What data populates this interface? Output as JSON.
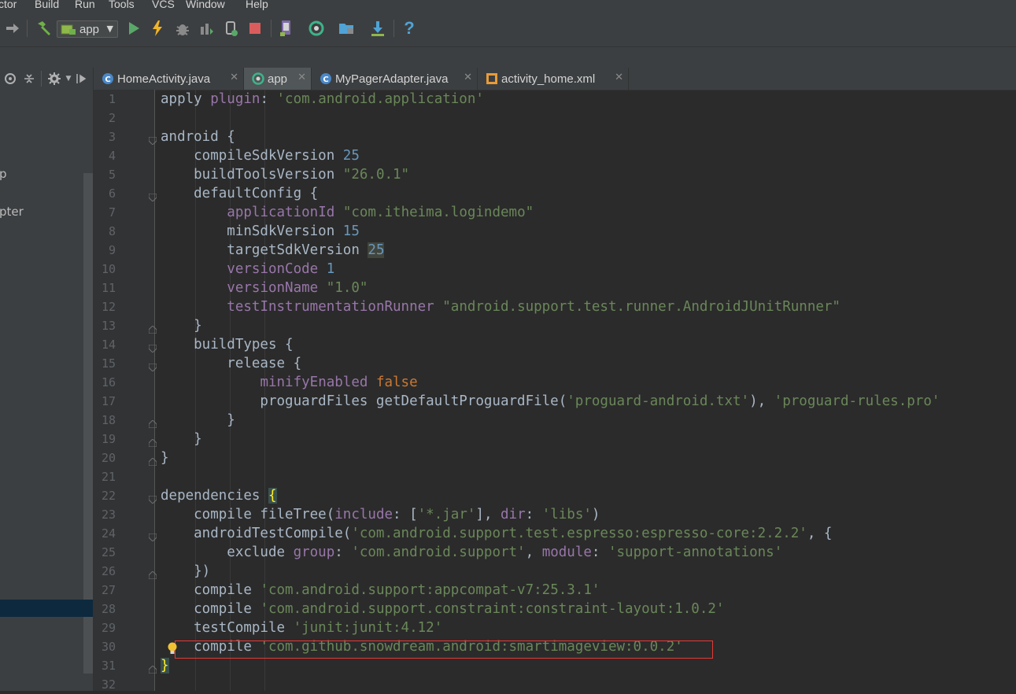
{
  "menu": [
    "ctor",
    "Build",
    "Run",
    "Tools",
    "VCS",
    "Window",
    "Help"
  ],
  "toolbar": {
    "run_config_label": "app",
    "icons": [
      "back-arrow-icon",
      "make-project-icon",
      "run-icon",
      "apply-changes-icon",
      "debug-icon",
      "profile-icon",
      "attach-debugger-icon",
      "stop-icon",
      "avd-manager-icon",
      "sync-gradle-icon",
      "project-structure-icon",
      "sdk-manager-icon",
      "help-icon"
    ]
  },
  "project_panel": {
    "tree_fragments": [
      "p",
      "pter"
    ],
    "toolbar_icons": [
      "locate-icon",
      "collapse-all-icon",
      "gear-icon",
      "hide-panel-icon"
    ]
  },
  "tabs": [
    {
      "label": "HomeActivity.java",
      "icon": "java-class-icon",
      "active": false
    },
    {
      "label": "app",
      "icon": "gradle-icon",
      "active": true
    },
    {
      "label": "MyPagerAdapter.java",
      "icon": "java-class-icon",
      "active": false
    },
    {
      "label": "activity_home.xml",
      "icon": "xml-layout-icon",
      "active": false
    }
  ],
  "editor": {
    "line_numbers": [
      "1",
      "2",
      "3",
      "4",
      "5",
      "6",
      "7",
      "8",
      "9",
      "10",
      "11",
      "12",
      "13",
      "14",
      "15",
      "16",
      "17",
      "18",
      "19",
      "20",
      "21",
      "22",
      "23",
      "24",
      "25",
      "26",
      "27",
      "28",
      "29",
      "30",
      "31",
      "32"
    ],
    "lines": [
      [
        {
          "t": "apply "
        },
        {
          "t": "plugin",
          "c": "p"
        },
        {
          "t": ": "
        },
        {
          "t": "'com.android.application'",
          "c": "s"
        }
      ],
      [],
      [
        {
          "t": "android {"
        }
      ],
      [
        {
          "t": "    compileSdkVersion "
        },
        {
          "t": "25",
          "c": "n"
        }
      ],
      [
        {
          "t": "    buildToolsVersion "
        },
        {
          "t": "\"26.0.1\"",
          "c": "s"
        }
      ],
      [
        {
          "t": "    defaultConfig {"
        }
      ],
      [
        {
          "t": "        "
        },
        {
          "t": "applicationId",
          "c": "p"
        },
        {
          "t": " "
        },
        {
          "t": "\"com.itheima.logindemo\"",
          "c": "s"
        }
      ],
      [
        {
          "t": "        minSdkVersion "
        },
        {
          "t": "15",
          "c": "n"
        }
      ],
      [
        {
          "t": "        targetSdkVersion "
        },
        {
          "t": "25",
          "c": "n hl25"
        }
      ],
      [
        {
          "t": "        "
        },
        {
          "t": "versionCode",
          "c": "p"
        },
        {
          "t": " "
        },
        {
          "t": "1",
          "c": "n"
        }
      ],
      [
        {
          "t": "        "
        },
        {
          "t": "versionName",
          "c": "p"
        },
        {
          "t": " "
        },
        {
          "t": "\"1.0\"",
          "c": "s"
        }
      ],
      [
        {
          "t": "        "
        },
        {
          "t": "testInstrumentationRunner",
          "c": "p"
        },
        {
          "t": " "
        },
        {
          "t": "\"android.support.test.runner.AndroidJUnitRunner\"",
          "c": "s"
        }
      ],
      [
        {
          "t": "    }"
        }
      ],
      [
        {
          "t": "    buildTypes {"
        }
      ],
      [
        {
          "t": "        release {"
        }
      ],
      [
        {
          "t": "            "
        },
        {
          "t": "minifyEnabled",
          "c": "p"
        },
        {
          "t": " "
        },
        {
          "t": "false",
          "c": "k"
        }
      ],
      [
        {
          "t": "            proguardFiles getDefaultProguardFile("
        },
        {
          "t": "'proguard-android.txt'",
          "c": "s"
        },
        {
          "t": "), "
        },
        {
          "t": "'proguard-rules.pro'",
          "c": "s"
        }
      ],
      [
        {
          "t": "        }"
        }
      ],
      [
        {
          "t": "    }"
        }
      ],
      [
        {
          "t": "}"
        }
      ],
      [],
      [
        {
          "t": "dependencies "
        },
        {
          "t": "{",
          "c": "brk"
        }
      ],
      [
        {
          "t": "    compile fileTree("
        },
        {
          "t": "include",
          "c": "p"
        },
        {
          "t": ": ["
        },
        {
          "t": "'*.jar'",
          "c": "s"
        },
        {
          "t": "], "
        },
        {
          "t": "dir",
          "c": "p"
        },
        {
          "t": ": "
        },
        {
          "t": "'libs'",
          "c": "s"
        },
        {
          "t": ")"
        }
      ],
      [
        {
          "t": "    androidTestCompile("
        },
        {
          "t": "'com.android.support.test.espresso:espresso-core:2.2.2'",
          "c": "s"
        },
        {
          "t": ", {"
        }
      ],
      [
        {
          "t": "        exclude "
        },
        {
          "t": "group",
          "c": "p"
        },
        {
          "t": ": "
        },
        {
          "t": "'com.android.support'",
          "c": "s"
        },
        {
          "t": ", "
        },
        {
          "t": "module",
          "c": "p"
        },
        {
          "t": ": "
        },
        {
          "t": "'support-annotations'",
          "c": "s"
        }
      ],
      [
        {
          "t": "    })"
        }
      ],
      [
        {
          "t": "    compile "
        },
        {
          "t": "'com.android.support:appcompat-v7:25.3.1'",
          "c": "s"
        }
      ],
      [
        {
          "t": "    compile "
        },
        {
          "t": "'com.android.support.constraint:constraint-layout:1.0.2'",
          "c": "s"
        }
      ],
      [
        {
          "t": "    testCompile "
        },
        {
          "t": "'junit:junit:4.12'",
          "c": "s"
        }
      ],
      [
        {
          "t": "    compile "
        },
        {
          "t": "'com.github.snowdream.android:smartimageview:0.0.2'",
          "c": "s"
        }
      ],
      [
        {
          "t": "}",
          "c": "brk"
        }
      ],
      []
    ]
  },
  "colors": {
    "editor_bg": "#2b2b2b",
    "keyword": "#cc7832",
    "number": "#6897bb",
    "string": "#6a8759",
    "property": "#9876aa",
    "highlight_box": "#e53935"
  }
}
